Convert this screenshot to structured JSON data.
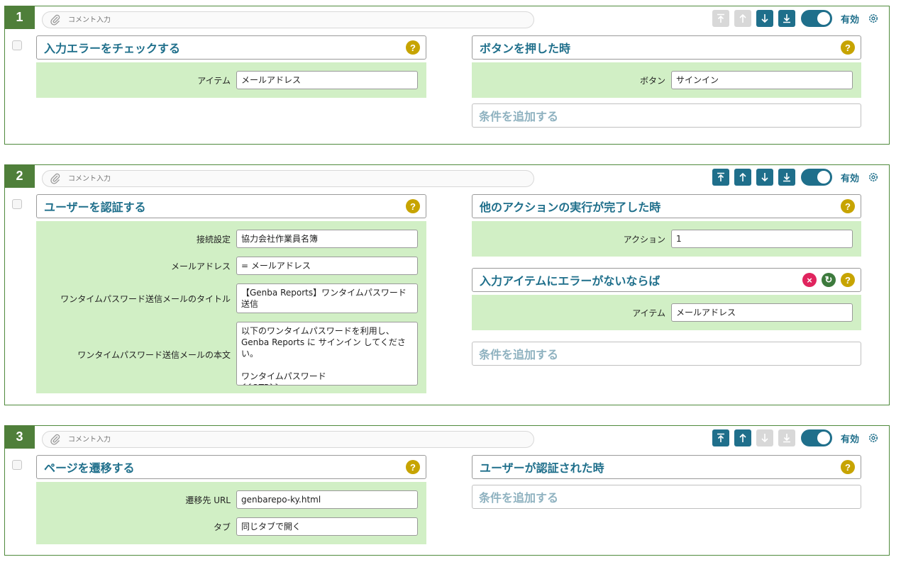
{
  "comment_placeholder": "コメント入力",
  "toggle_label": "有効",
  "help_glyph": "?",
  "rules": [
    {
      "number": "1",
      "buttons_disabled": {
        "top": true,
        "up": true,
        "down": false,
        "bottom": false
      },
      "action": {
        "title": "入力エラーをチェックする",
        "fields": [
          {
            "label": "アイテム",
            "value": "メールアドレス"
          }
        ]
      },
      "triggers": [
        {
          "title": "ボタンを押した時",
          "fields": [
            {
              "label": "ボタン",
              "value": "サインイン"
            }
          ]
        }
      ],
      "add_condition": "条件を追加する"
    },
    {
      "number": "2",
      "buttons_disabled": {
        "top": false,
        "up": false,
        "down": false,
        "bottom": false
      },
      "action": {
        "title": "ユーザーを認証する",
        "fields": [
          {
            "label": "接続設定",
            "value": "協力会社作業員名簿"
          },
          {
            "label": "メールアドレス",
            "value": "= メールアドレス"
          },
          {
            "label": "ワンタイムパスワード送信メールのタイトル",
            "value": "【Genba Reports】ワンタイムパスワード送信"
          },
          {
            "label": "ワンタイムパスワード送信メールの本文",
            "value": "以下のワンタイムパスワードを利用し、\nGenba Reports に サインイン してください。\n\nワンタイムパスワード\n{{OTP}}"
          }
        ]
      },
      "triggers": [
        {
          "title": "他のアクションの実行が完了した時",
          "fields": [
            {
              "label": "アクション",
              "value": "1"
            }
          ]
        },
        {
          "title": "入力アイテムにエラーがないならば",
          "fields": [
            {
              "label": "アイテム",
              "value": "メールアドレス"
            }
          ],
          "remove_glyph": "×",
          "refresh_glyph": "↻"
        }
      ],
      "add_condition": "条件を追加する"
    },
    {
      "number": "3",
      "buttons_disabled": {
        "top": false,
        "up": false,
        "down": true,
        "bottom": true
      },
      "action": {
        "title": "ページを遷移する",
        "fields": [
          {
            "label": "遷移先 URL",
            "value": "genbarepo-ky.html"
          },
          {
            "label": "タブ",
            "value": "同じタブで開く"
          }
        ]
      },
      "triggers": [
        {
          "title": "ユーザーが認証された時",
          "fields": []
        }
      ],
      "add_condition": "条件を追加する"
    }
  ]
}
